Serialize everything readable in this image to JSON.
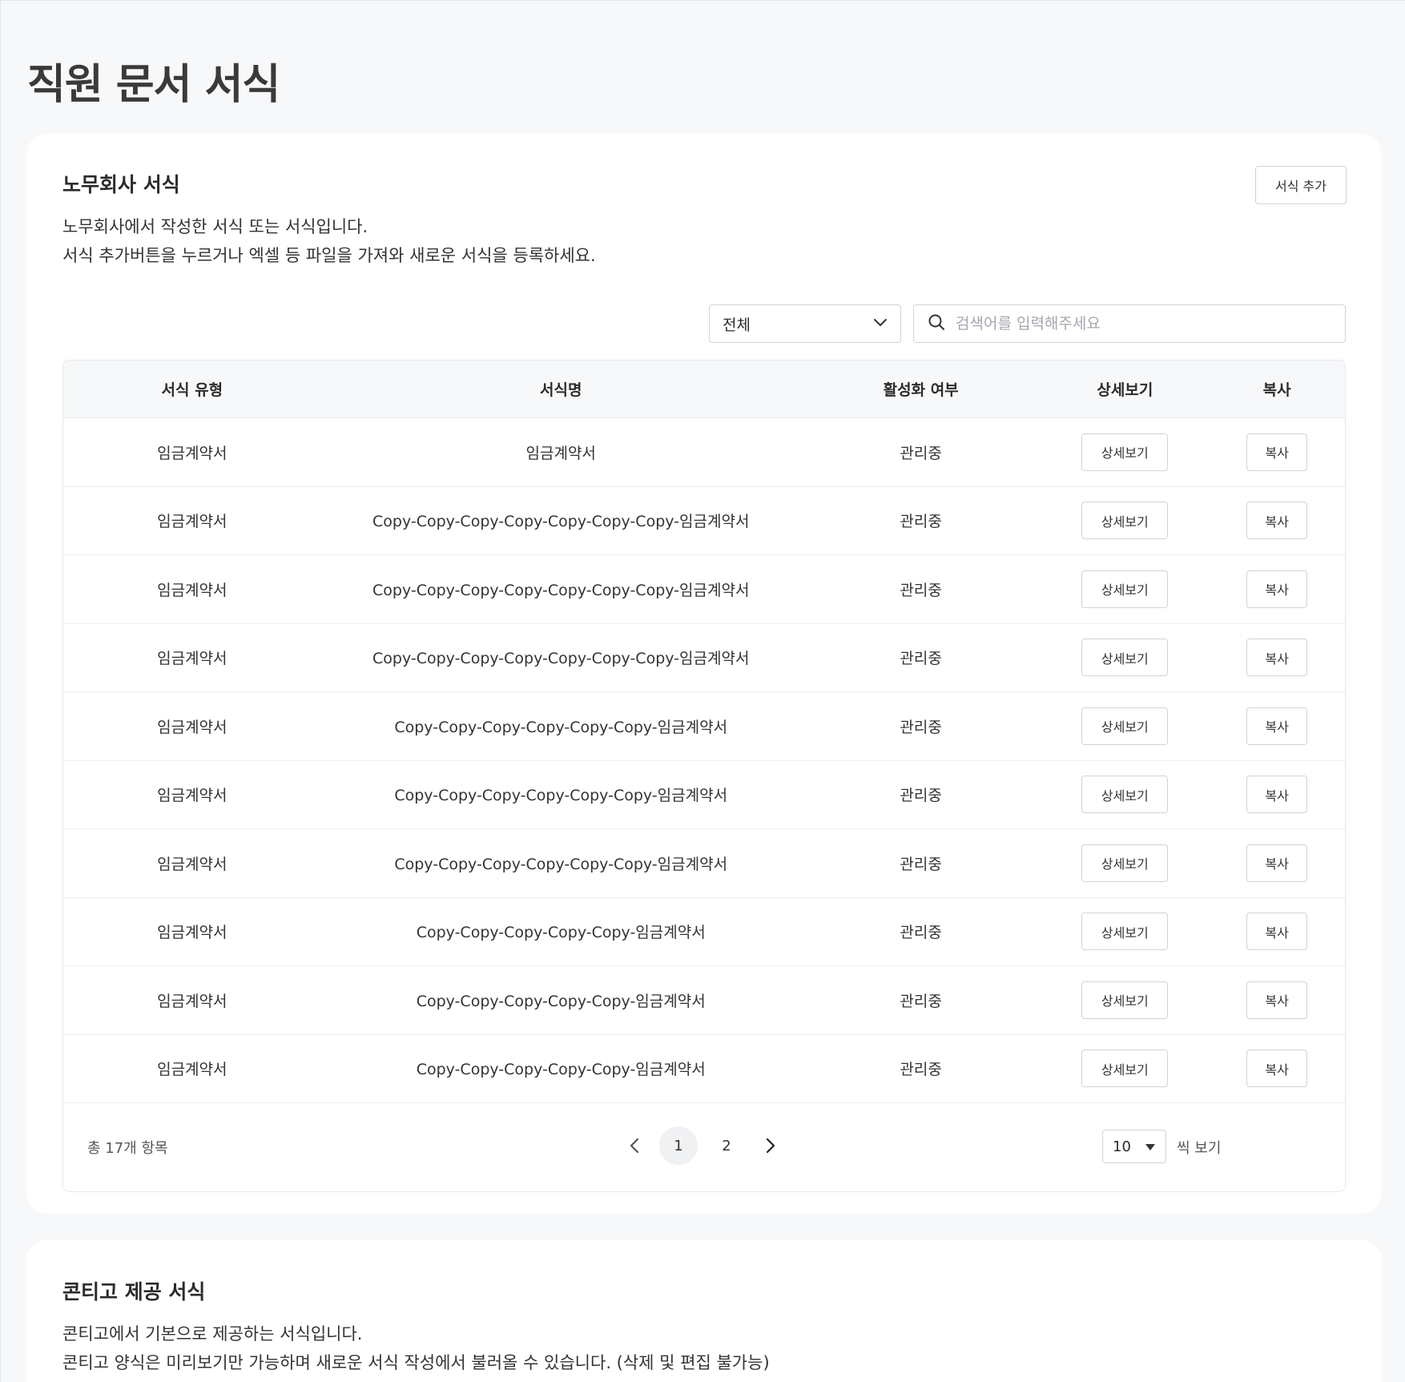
{
  "page": {
    "title": "직원 문서 서식"
  },
  "section1": {
    "title": "노무회사 서식",
    "desc_line1": "노무회사에서 작성한 서식 또는 서식입니다.",
    "desc_line2": "서식 추가버튼을 누르거나 엑셀 등 파일을 가져와 새로운 서식을 등록하세요.",
    "add_button": "서식 추가",
    "filter": {
      "selected": "전체"
    },
    "search": {
      "placeholder": "검색어를 입력해주세요"
    },
    "columns": [
      "서식 유형",
      "서식명",
      "활성화 여부",
      "상세보기",
      "복사"
    ],
    "rows": [
      {
        "type": "임금계약서",
        "name": "임금계약서",
        "status": "관리중",
        "detail": "상세보기",
        "copy": "복사"
      },
      {
        "type": "임금계약서",
        "name": "Copy-Copy-Copy-Copy-Copy-Copy-Copy-임금계약서",
        "status": "관리중",
        "detail": "상세보기",
        "copy": "복사"
      },
      {
        "type": "임금계약서",
        "name": "Copy-Copy-Copy-Copy-Copy-Copy-Copy-임금계약서",
        "status": "관리중",
        "detail": "상세보기",
        "copy": "복사"
      },
      {
        "type": "임금계약서",
        "name": "Copy-Copy-Copy-Copy-Copy-Copy-Copy-임금계약서",
        "status": "관리중",
        "detail": "상세보기",
        "copy": "복사"
      },
      {
        "type": "임금계약서",
        "name": "Copy-Copy-Copy-Copy-Copy-Copy-임금계약서",
        "status": "관리중",
        "detail": "상세보기",
        "copy": "복사"
      },
      {
        "type": "임금계약서",
        "name": "Copy-Copy-Copy-Copy-Copy-Copy-임금계약서",
        "status": "관리중",
        "detail": "상세보기",
        "copy": "복사"
      },
      {
        "type": "임금계약서",
        "name": "Copy-Copy-Copy-Copy-Copy-Copy-임금계약서",
        "status": "관리중",
        "detail": "상세보기",
        "copy": "복사"
      },
      {
        "type": "임금계약서",
        "name": "Copy-Copy-Copy-Copy-Copy-임금계약서",
        "status": "관리중",
        "detail": "상세보기",
        "copy": "복사"
      },
      {
        "type": "임금계약서",
        "name": "Copy-Copy-Copy-Copy-Copy-임금계약서",
        "status": "관리중",
        "detail": "상세보기",
        "copy": "복사"
      },
      {
        "type": "임금계약서",
        "name": "Copy-Copy-Copy-Copy-Copy-임금계약서",
        "status": "관리중",
        "detail": "상세보기",
        "copy": "복사"
      }
    ],
    "footer": {
      "total": "총 17개 항목",
      "pages": [
        "1",
        "2"
      ],
      "current_page": "1",
      "per_page": "10",
      "per_page_label": "씩 보기"
    }
  },
  "section2": {
    "title": "콘티고 제공 서식",
    "desc_line1": "콘티고에서 기본으로 제공하는 서식입니다.",
    "desc_line2": "콘티고 양식은 미리보기만 가능하며 새로운 서식 작성에서 불러올 수 있습니다. (삭제 및 편집 불가능)"
  },
  "icons": {
    "filter_chevron": "chevron-down-icon",
    "search": "search-icon",
    "prev": "chevron-left-icon",
    "next": "chevron-right-icon",
    "per_page_caret": "caret-down-icon"
  }
}
